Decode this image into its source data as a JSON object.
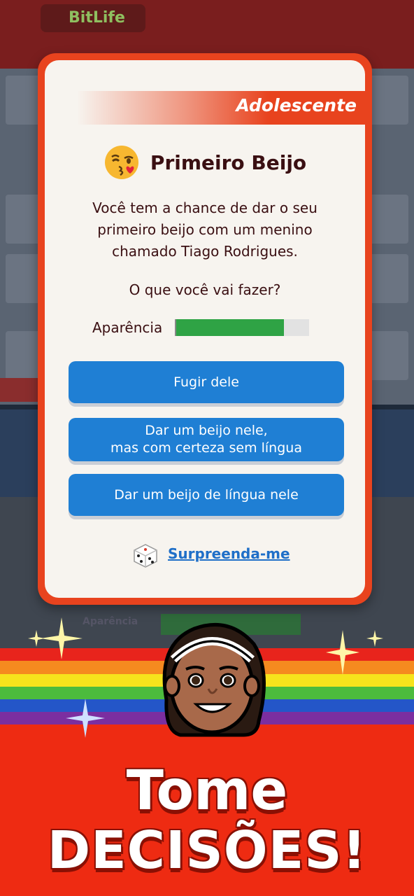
{
  "background": {
    "logo_text": "BitLife",
    "side_label": "Aparência"
  },
  "modal": {
    "stage": "Adolescente",
    "title": "Primeiro Beijo",
    "title_icon": "kissing-face-emoji-icon",
    "description": "Você tem a chance de dar o seu primeiro beijo com um menino chamado Tiago Rodrigues.",
    "question": "O que você vai fazer?",
    "stat": {
      "label": "Aparência",
      "value_percent": 81
    },
    "choices": [
      {
        "line1": "Fugir dele",
        "line2": ""
      },
      {
        "line1": "Dar um beijo nele,",
        "line2": "mas com certeza sem língua"
      },
      {
        "line1": "Dar um beijo de língua nele",
        "line2": ""
      }
    ],
    "surprise": {
      "label": "Surpreenda-me",
      "icon": "dice-icon"
    }
  },
  "promo": {
    "line1": "Tome",
    "line2": "DECISÕES!"
  },
  "colors": {
    "accent_red": "#e8431e",
    "button_blue": "#1f7fd4",
    "stat_green": "#2fa345",
    "promo_red": "#ee2b12",
    "text_dark": "#3a0f12",
    "link_blue": "#1f6fc8"
  }
}
